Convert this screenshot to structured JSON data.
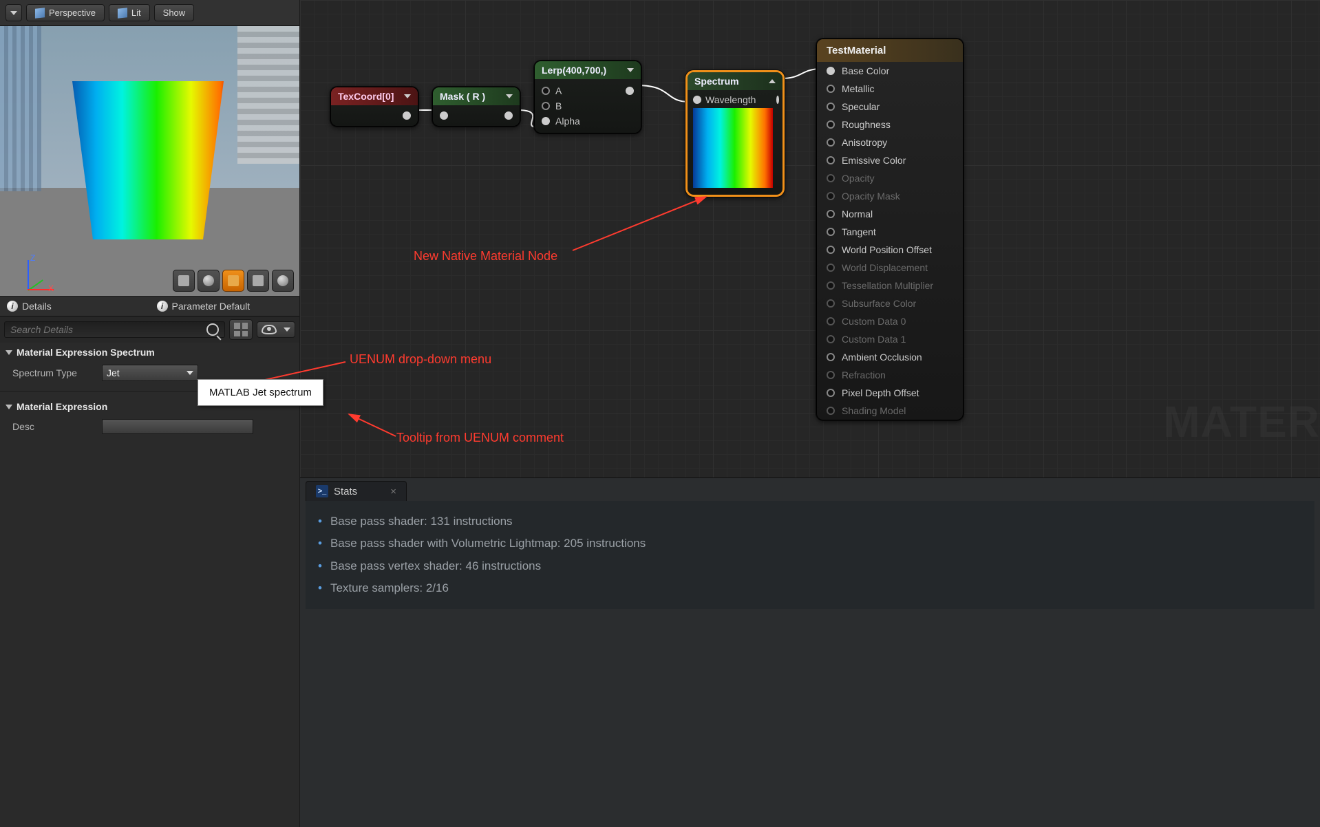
{
  "toolbar": {
    "perspective": "Perspective",
    "lit": "Lit",
    "show": "Show"
  },
  "tabs": {
    "details": "Details",
    "param_default": "Parameter Default"
  },
  "search": {
    "placeholder": "Search Details"
  },
  "section_spectrum": {
    "title": "Material Expression Spectrum",
    "prop_label": "Spectrum Type",
    "value": "Jet",
    "tooltip": "MATLAB Jet spectrum"
  },
  "section_expression": {
    "title": "Material Expression",
    "prop_label": "Desc"
  },
  "gizmo": {
    "z": "Z",
    "x": "X"
  },
  "nodes": {
    "texcoord": {
      "title": "TexCoord[0]"
    },
    "mask": {
      "title": "Mask ( R )"
    },
    "lerp": {
      "title": "Lerp(400,700,)",
      "pins": [
        "A",
        "B",
        "Alpha"
      ]
    },
    "spectrum": {
      "title": "Spectrum",
      "input": "Wavelength"
    },
    "output": {
      "title": "TestMaterial",
      "pins": [
        {
          "label": "Base Color",
          "enabled": true,
          "connected": true
        },
        {
          "label": "Metallic",
          "enabled": true,
          "connected": false
        },
        {
          "label": "Specular",
          "enabled": true,
          "connected": false
        },
        {
          "label": "Roughness",
          "enabled": true,
          "connected": false
        },
        {
          "label": "Anisotropy",
          "enabled": true,
          "connected": false
        },
        {
          "label": "Emissive Color",
          "enabled": true,
          "connected": false
        },
        {
          "label": "Opacity",
          "enabled": false,
          "connected": false
        },
        {
          "label": "Opacity Mask",
          "enabled": false,
          "connected": false
        },
        {
          "label": "Normal",
          "enabled": true,
          "connected": false
        },
        {
          "label": "Tangent",
          "enabled": true,
          "connected": false
        },
        {
          "label": "World Position Offset",
          "enabled": true,
          "connected": false
        },
        {
          "label": "World Displacement",
          "enabled": false,
          "connected": false
        },
        {
          "label": "Tessellation Multiplier",
          "enabled": false,
          "connected": false
        },
        {
          "label": "Subsurface Color",
          "enabled": false,
          "connected": false
        },
        {
          "label": "Custom Data 0",
          "enabled": false,
          "connected": false
        },
        {
          "label": "Custom Data 1",
          "enabled": false,
          "connected": false
        },
        {
          "label": "Ambient Occlusion",
          "enabled": true,
          "connected": false
        },
        {
          "label": "Refraction",
          "enabled": false,
          "connected": false
        },
        {
          "label": "Pixel Depth Offset",
          "enabled": true,
          "connected": false
        },
        {
          "label": "Shading Model",
          "enabled": false,
          "connected": false
        }
      ]
    }
  },
  "annotations": {
    "node": "New Native Material Node",
    "enum": "UENUM drop-down menu",
    "tooltip": "Tooltip from UENUM comment"
  },
  "watermark": "MATER",
  "stats": {
    "title": "Stats",
    "lines": [
      "Base pass shader: 131 instructions",
      "Base pass shader with Volumetric Lightmap: 205 instructions",
      "Base pass vertex shader: 46 instructions",
      "Texture samplers: 2/16"
    ]
  }
}
